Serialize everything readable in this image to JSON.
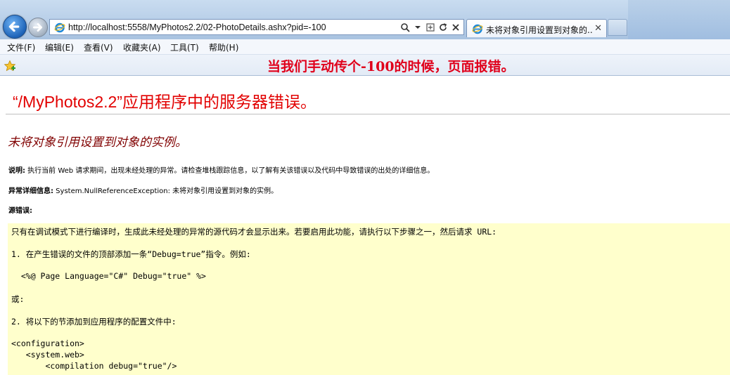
{
  "browser": {
    "address": "http://localhost:5558/MyPhotos2.2/02-PhotoDetails.ashx?pid=-100",
    "tab_title": "未将对象引用设置到对象的...",
    "tab_close": "✕"
  },
  "menu": [
    {
      "label": "文件(F)"
    },
    {
      "label": "编辑(E)"
    },
    {
      "label": "查看(V)"
    },
    {
      "label": "收藏夹(A)"
    },
    {
      "label": "工具(T)"
    },
    {
      "label": "帮助(H)"
    }
  ],
  "annotation": "当我们手动传个-100的时候，页面报错。",
  "error_page": {
    "title": "“/MyPhotos2.2”应用程序中的服务器错误。",
    "subtitle": "未将对象引用设置到对象的实例。",
    "description_label": "说明:",
    "description_text": " 执行当前 Web 请求期间，出现未经处理的异常。请检查堆栈跟踪信息，以了解有关该错误以及代码中导致错误的出处的详细信息。",
    "exception_label": "异常详细信息:",
    "exception_text": " System.NullReferenceException: 未将对象引用设置到对象的实例。",
    "source_label": "源错误:",
    "code_lines": [
      "只有在调试模式下进行编译时，生成此未经处理的异常的源代码才会显示出来。若要启用此功能，请执行以下步骤之一，然后请求 URL:",
      "1. 在产生错误的文件的顶部添加一条“Debug=true”指令。例如:",
      "  <%@ Page Language=\"C#\" Debug=\"true\" %>",
      "或:",
      "2. 将以下的节添加到应用程序的配置文件中:",
      "<configuration>",
      "   <system.web>",
      "       <compilation debug=\"true\"/>"
    ]
  },
  "colors": {
    "error_title": "#e20000",
    "error_subtitle": "#800000",
    "annotation": "#e0001b",
    "code_bg": "#ffffcc"
  },
  "icons": {
    "back": "back-arrow-icon",
    "forward": "forward-arrow-icon",
    "ie": "ie-logo-icon",
    "search": "search-icon",
    "refresh": "refresh-icon",
    "stop": "stop-icon",
    "favorites": "add-favorite-star-icon"
  }
}
